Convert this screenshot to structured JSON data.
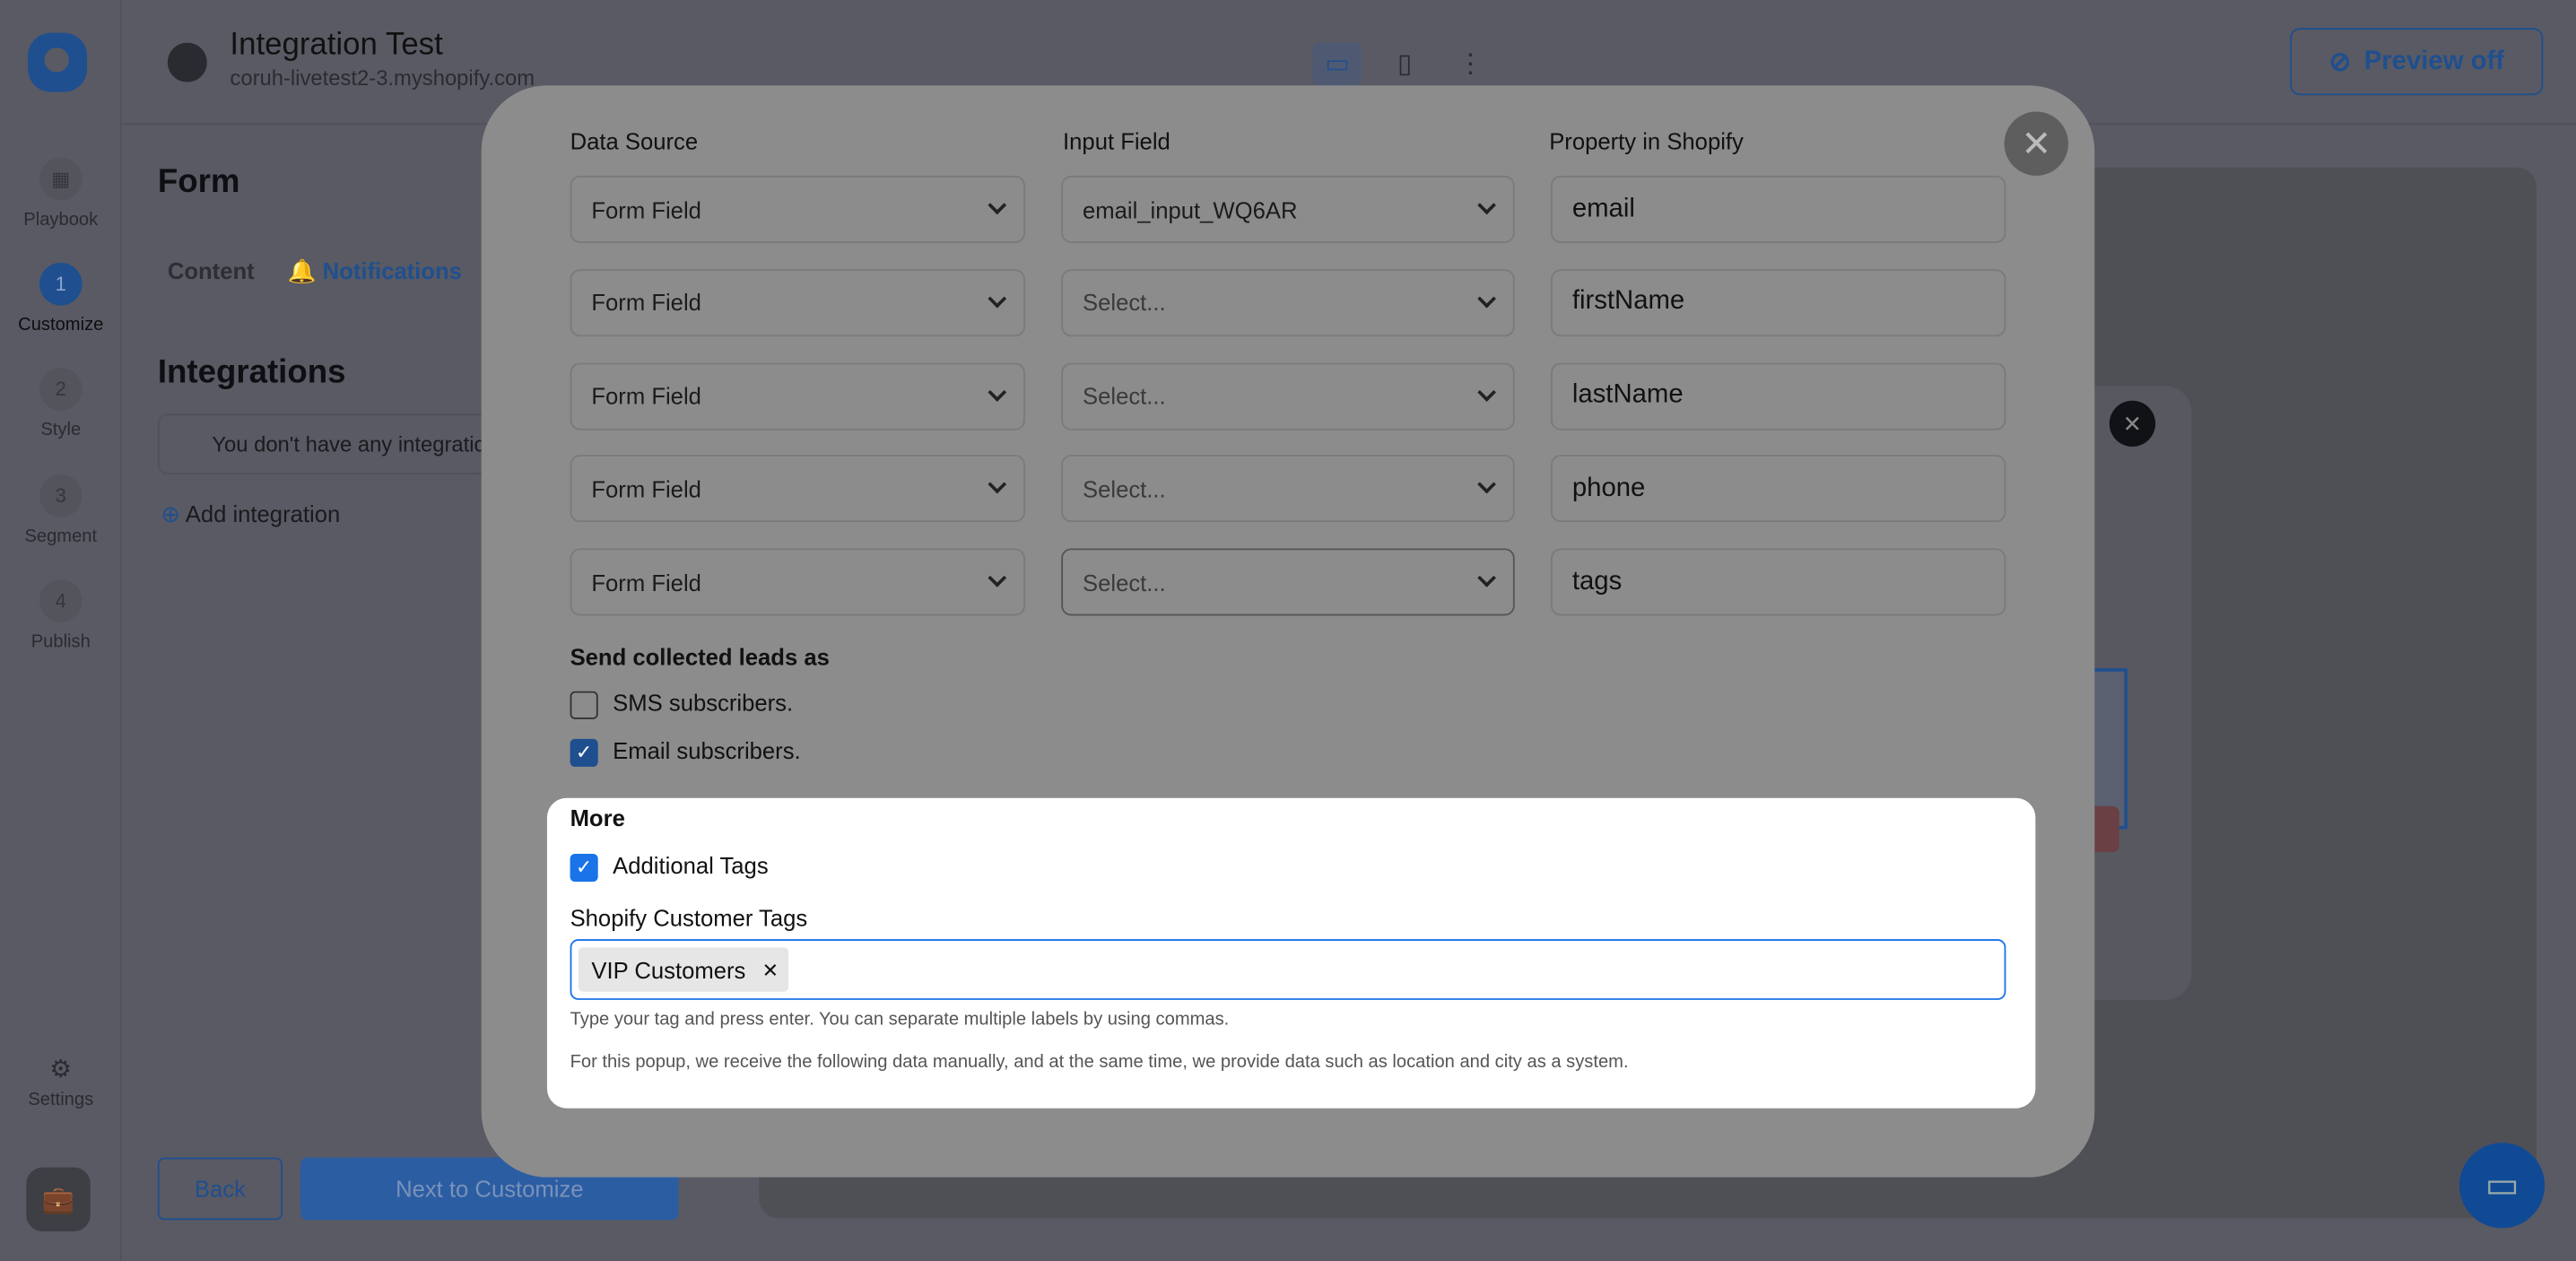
{
  "app": {
    "title": "Integration Test",
    "subtitle": "coruh-livetest2-3.myshopify.com",
    "preview_label": "Preview off"
  },
  "nav": {
    "steps": [
      {
        "num": "",
        "label": "Playbook",
        "icon": "grid-icon"
      },
      {
        "num": "1",
        "label": "Customize"
      },
      {
        "num": "2",
        "label": "Style"
      },
      {
        "num": "3",
        "label": "Segment"
      },
      {
        "num": "4",
        "label": "Publish"
      }
    ],
    "settings": "Settings"
  },
  "page": {
    "title": "Form",
    "tabs": [
      "Content",
      "Notifications"
    ],
    "integrations_title": "Integrations",
    "empty_text": "You don't have any integratio",
    "add_integration": "Add integration",
    "back": "Back",
    "next": "Next to Customize"
  },
  "modal": {
    "headers": [
      "Data Source",
      "Input Field",
      "Property in Shopify"
    ],
    "rows": [
      {
        "source": "Form Field",
        "input": "email_input_WQ6AR",
        "property": "email"
      },
      {
        "source": "Form Field",
        "input": "Select...",
        "property": "firstName"
      },
      {
        "source": "Form Field",
        "input": "Select...",
        "property": "lastName"
      },
      {
        "source": "Form Field",
        "input": "Select...",
        "property": "phone"
      },
      {
        "source": "Form Field",
        "input": "Select...",
        "property": "tags"
      }
    ],
    "send_title": "Send collected leads as",
    "sms": {
      "label": "SMS subscribers.",
      "checked": false
    },
    "email": {
      "label": "Email subscribers.",
      "checked": true
    },
    "more_title": "More",
    "additional": {
      "label": "Additional Tags",
      "checked": true
    },
    "tags_label": "Shopify Customer Tags",
    "tags": [
      "VIP Customers"
    ],
    "hint": "Type your tag and press enter. You can separate multiple labels by using commas.",
    "note": "For this popup, we receive the following data manually, and at the same time, we provide data such as location and city as a system."
  },
  "colors": {
    "accent": "#1a73e8",
    "overlay_modal": "#8c8c8c"
  }
}
